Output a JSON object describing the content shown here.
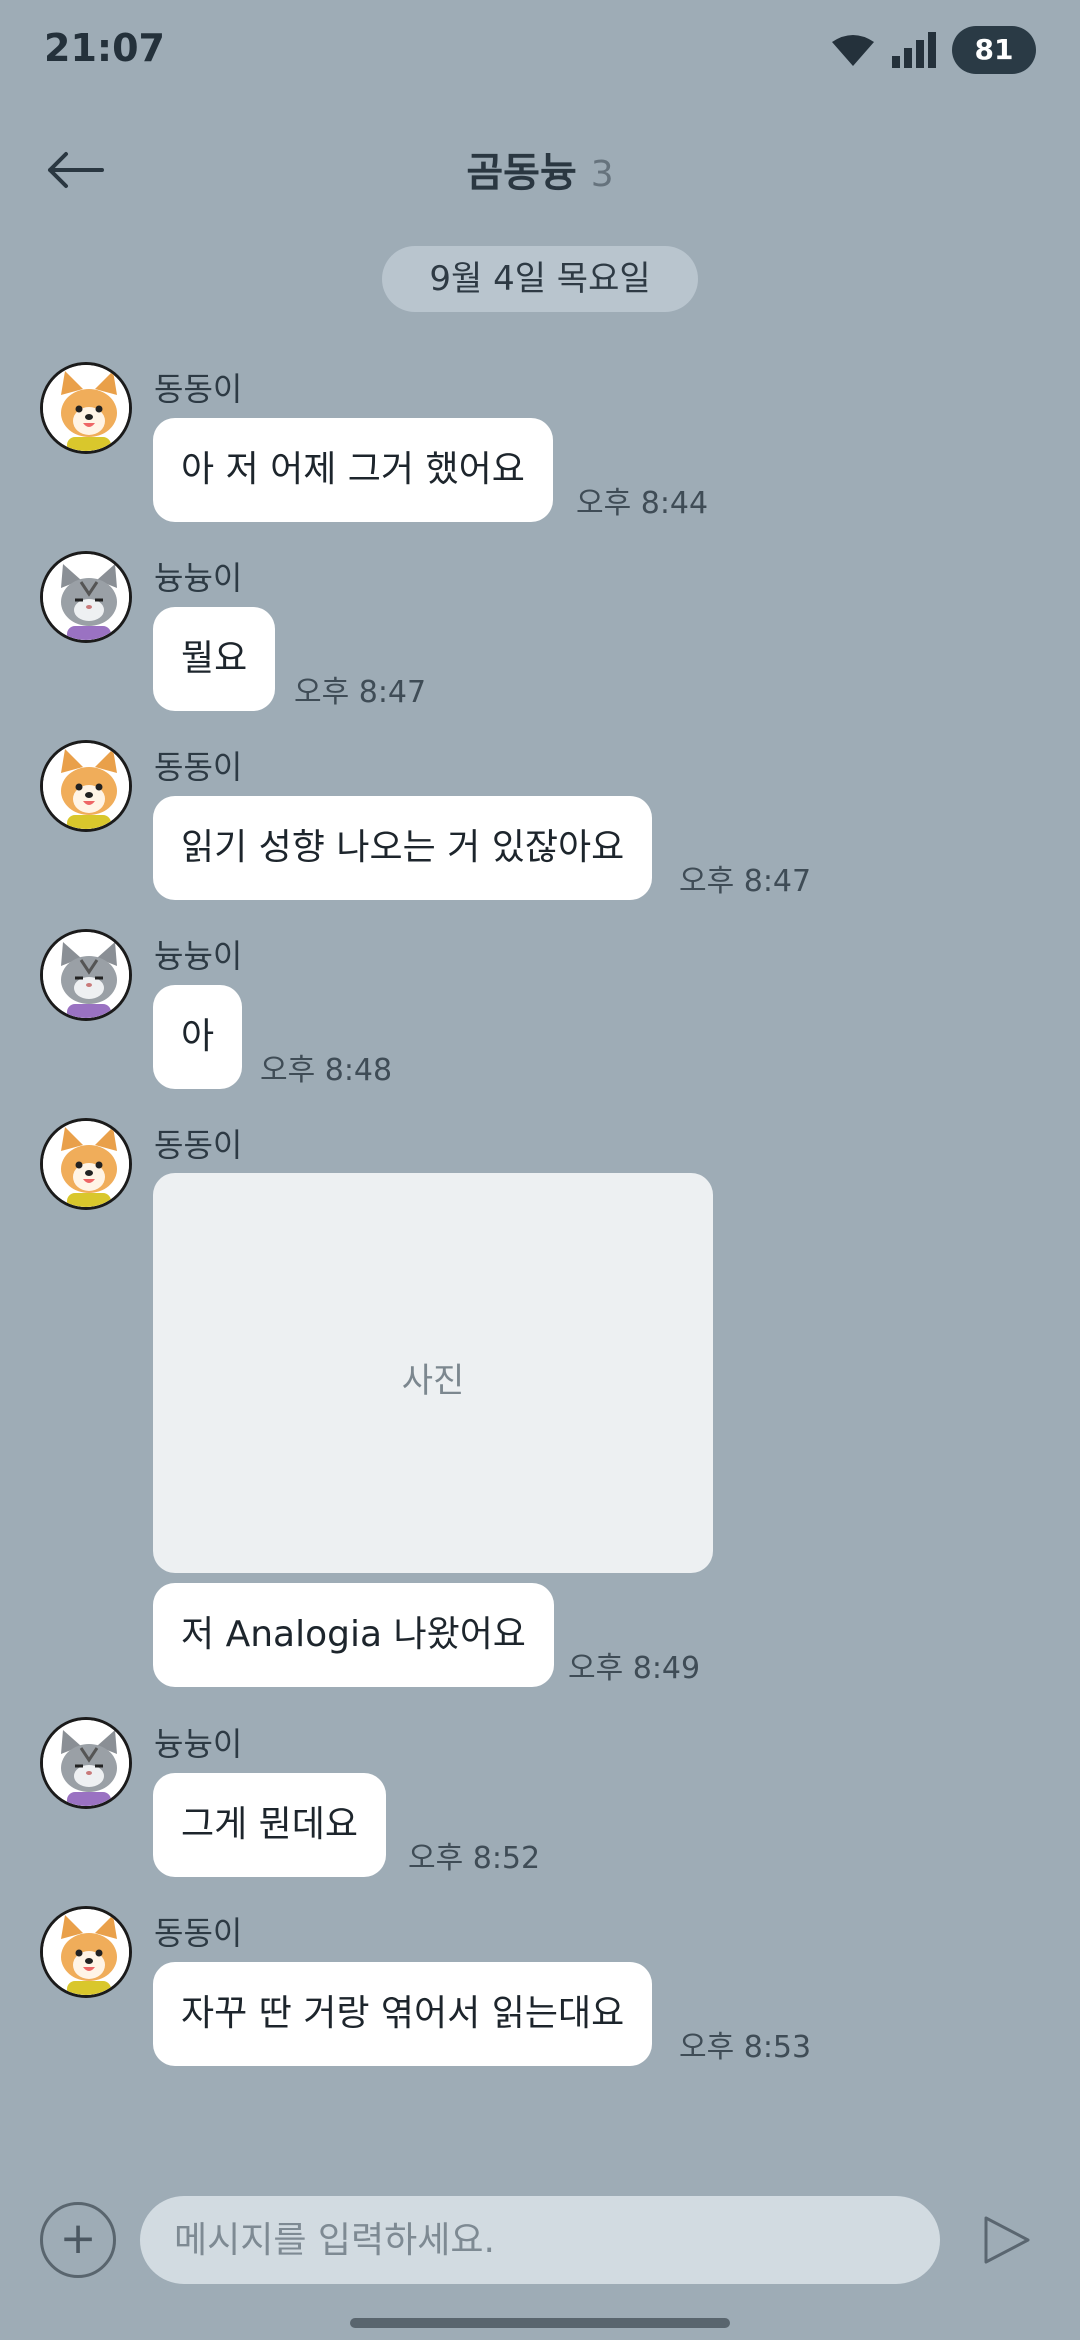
{
  "status_bar": {
    "time": "21:07",
    "battery": "81"
  },
  "header": {
    "title": "곰동늉",
    "member_count": "3"
  },
  "date_divider": "9월 4일 목요일",
  "messages": [
    {
      "sender": "동동이",
      "avatar": "dog-avatar",
      "text": "아 저 어제 그거 했어요",
      "time": "오후 8:44"
    },
    {
      "sender": "늉늉이",
      "avatar": "cat-avatar",
      "text": "뭘요",
      "time": "오후 8:47"
    },
    {
      "sender": "동동이",
      "avatar": "dog-avatar",
      "text": "읽기 성향 나오는 거 있잖아요",
      "time": "오후 8:47"
    },
    {
      "sender": "늉늉이",
      "avatar": "cat-avatar",
      "text": "아",
      "time": "오후 8:48"
    },
    {
      "sender": "동동이",
      "avatar": "dog-avatar",
      "photo_label": "사진",
      "text": "저 Analogia 나왔어요",
      "time": "오후 8:49"
    },
    {
      "sender": "늉늉이",
      "avatar": "cat-avatar",
      "text": "그게 뭔데요",
      "time": "오후 8:52"
    },
    {
      "sender": "동동이",
      "avatar": "dog-avatar",
      "text": "자꾸 딴 거랑 엮어서 읽는대요",
      "time": "오후 8:53"
    }
  ],
  "input_bar": {
    "plus_label": "+",
    "placeholder": "메시지를 입력하세요."
  },
  "colors": {
    "background": "#9eacb6",
    "bubble": "#ffffff",
    "date_pill": "#b9c5ce",
    "input": "#d2dbe1"
  }
}
